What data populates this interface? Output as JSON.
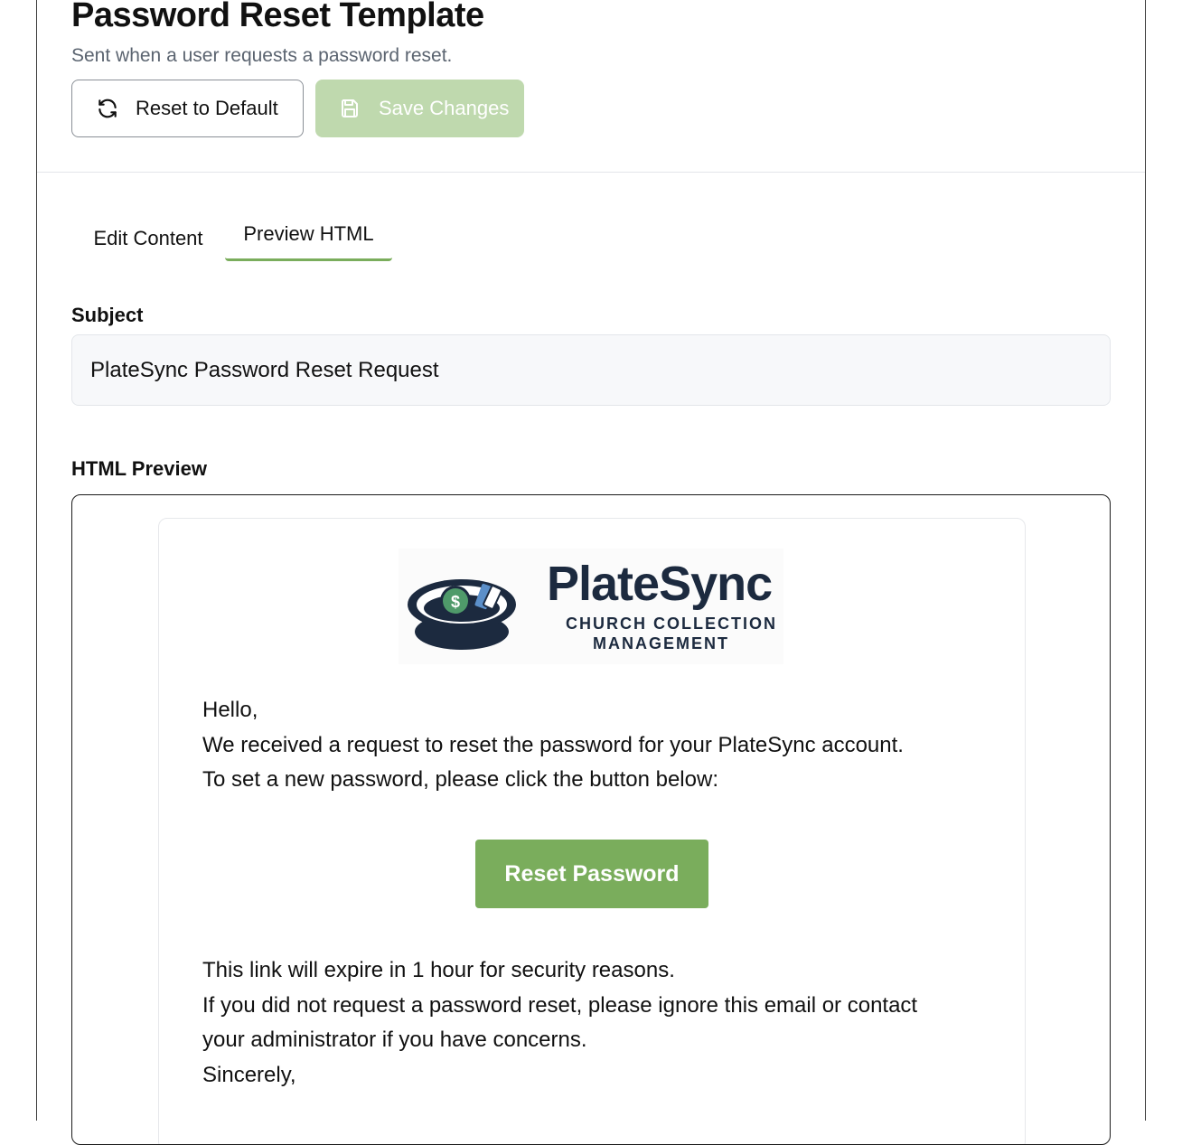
{
  "header": {
    "title": "Password Reset Template",
    "subtitle": "Sent when a user requests a password reset.",
    "reset_label": "Reset to Default",
    "save_label": "Save Changes"
  },
  "tabs": [
    {
      "label": "Edit Content",
      "active": false
    },
    {
      "label": "Preview HTML",
      "active": true
    }
  ],
  "subject": {
    "label": "Subject",
    "value": "PlateSync Password Reset Request"
  },
  "preview": {
    "label": "HTML Preview",
    "logo": {
      "wordmark": "PlateSync",
      "tagline_line1": "CHURCH COLLECTION",
      "tagline_line2": "MANAGEMENT",
      "icon": "collection-plate-icon"
    },
    "lines_top": [
      "Hello,",
      "We received a request to reset the password for your PlateSync account.",
      "To set a new password, please click the button below:"
    ],
    "cta_label": "Reset Password",
    "lines_bottom": [
      "This link will expire in 1 hour for security reasons.",
      "If you did not request a password reset, please ignore this email or contact",
      "your administrator if you have concerns.",
      "Sincerely,"
    ]
  },
  "colors": {
    "accent": "#7aad5c",
    "accent_disabled": "#bfd9ae",
    "logo_navy": "#1c2a3f"
  },
  "icons": {
    "reset": "refresh-icon",
    "save": "save-icon"
  }
}
